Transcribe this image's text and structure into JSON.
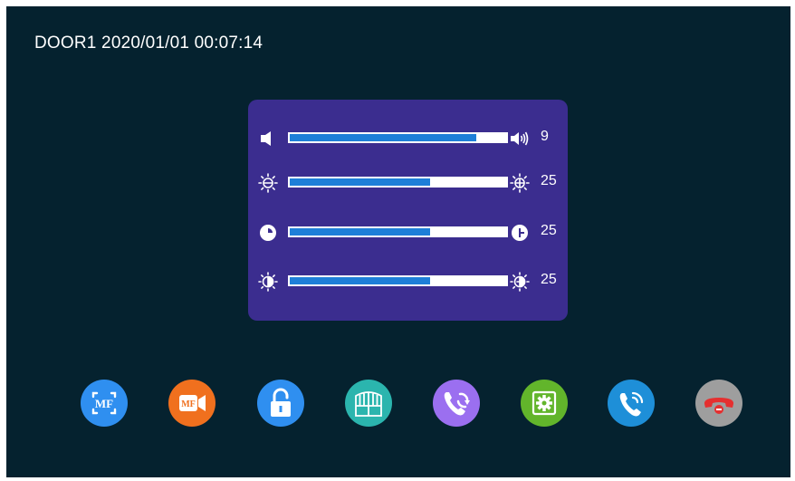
{
  "status_bar": {
    "text": "DOOR1 2020/01/01 00:07:14"
  },
  "adjust_panel": {
    "rows": [
      {
        "name": "volume",
        "left_icon": "speaker-low-icon",
        "right_icon": "speaker-high-icon",
        "value": "9",
        "level_fraction": 0.86
      },
      {
        "name": "brightness",
        "left_icon": "brightness-low-icon",
        "right_icon": "brightness-high-icon",
        "value": "25",
        "level_fraction": 0.65
      },
      {
        "name": "contrast",
        "left_icon": "contrast-low-icon",
        "right_icon": "contrast-high-icon",
        "value": "25",
        "level_fraction": 0.65
      },
      {
        "name": "color",
        "left_icon": "color-low-icon",
        "right_icon": "color-high-icon",
        "value": "25",
        "level_fraction": 0.65
      }
    ]
  },
  "dock": {
    "buttons": [
      {
        "name": "snapshot",
        "icon": "mf-photo-icon",
        "label": "MF",
        "color": "#2f8ff0"
      },
      {
        "name": "record",
        "icon": "mf-video-icon",
        "label": "MF",
        "color": "#f0701e"
      },
      {
        "name": "unlock",
        "icon": "padlock-icon",
        "color": "#2f8ff0"
      },
      {
        "name": "gate",
        "icon": "gate-icon",
        "color": "#2bb5ae"
      },
      {
        "name": "transfer",
        "icon": "phone-transfer-icon",
        "color": "#9b6ff0"
      },
      {
        "name": "settings",
        "icon": "gear-icon",
        "color": "#62b52b"
      },
      {
        "name": "answer",
        "icon": "phone-answer-icon",
        "color": "#1e8fd8"
      },
      {
        "name": "hangup",
        "icon": "phone-hangup-icon",
        "color": "#9e9e9e"
      }
    ]
  }
}
